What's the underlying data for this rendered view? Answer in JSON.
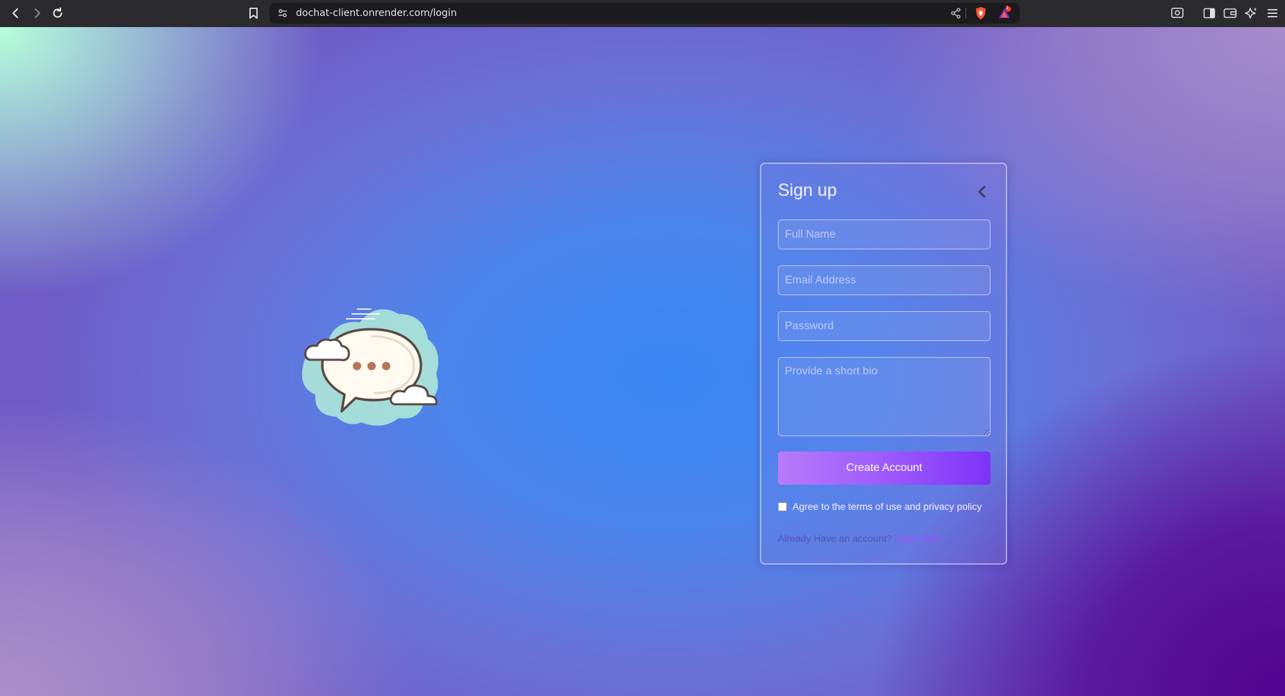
{
  "browser": {
    "url": "dochat-client.onrender.com/login",
    "notification_count": "1"
  },
  "signup": {
    "title": "Sign up",
    "full_name_placeholder": "Full Name",
    "email_placeholder": "Email Address",
    "password_placeholder": "Password",
    "bio_placeholder": "Provide a short bio",
    "create_button": "Create Account",
    "terms_label": "Agree to the terms of use and privacy policy",
    "footer_text": "Already Have an account?",
    "login_link": "Login here"
  },
  "colors": {
    "button_start": "#b67cf9",
    "button_end": "#7d33f7",
    "link": "#9c4dff"
  },
  "icons": {
    "back": "chevron-left-icon",
    "logo": "chat-bubble-cloud-icon"
  }
}
